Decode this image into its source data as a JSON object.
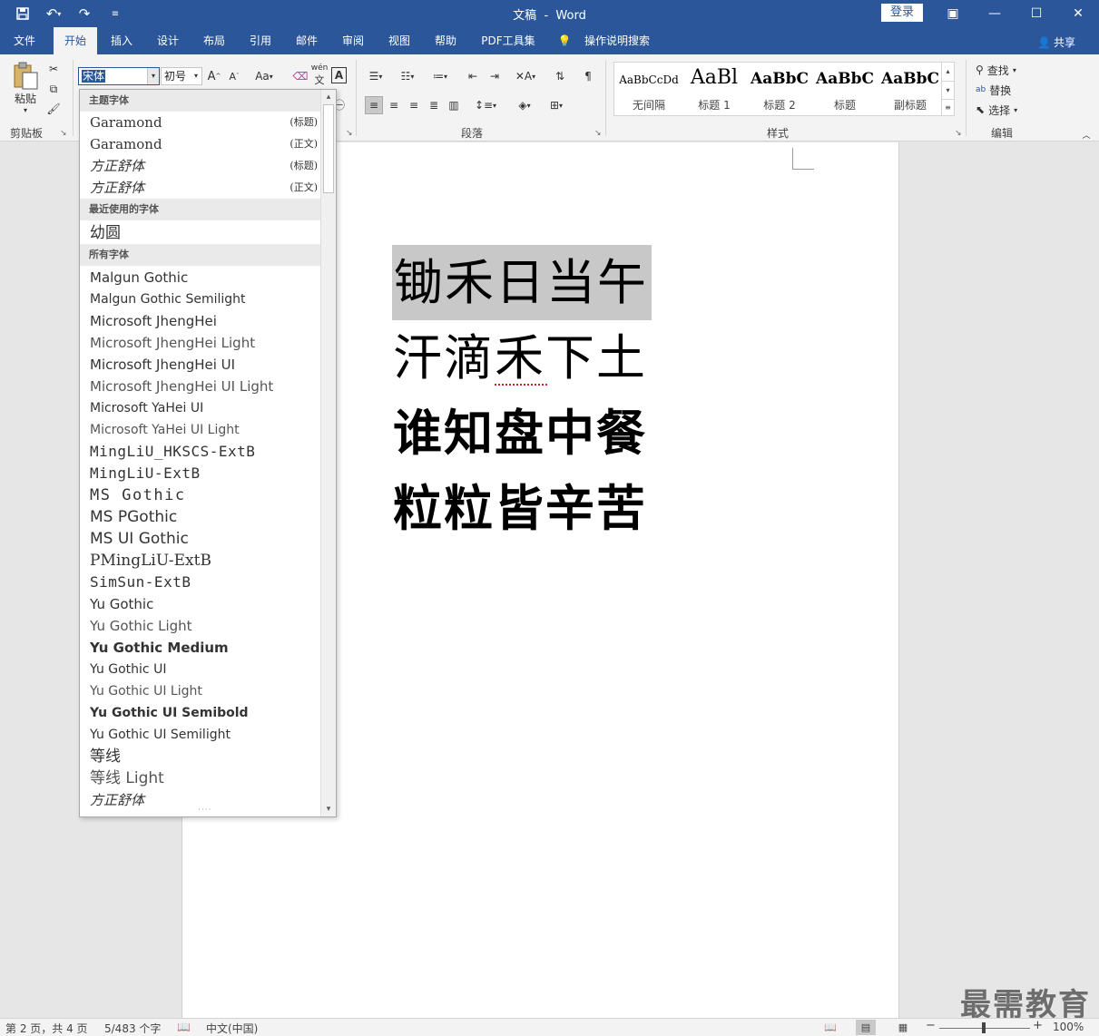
{
  "titlebar": {
    "doc_title": "文稿",
    "separator": "-",
    "app_name": "Word",
    "login_label": "登录"
  },
  "tabs": [
    {
      "label": "文件"
    },
    {
      "label": "开始"
    },
    {
      "label": "插入"
    },
    {
      "label": "设计"
    },
    {
      "label": "布局"
    },
    {
      "label": "引用"
    },
    {
      "label": "邮件"
    },
    {
      "label": "审阅"
    },
    {
      "label": "视图"
    },
    {
      "label": "帮助"
    },
    {
      "label": "PDF工具集"
    },
    {
      "label": "操作说明搜索"
    }
  ],
  "share_label": "共享",
  "ribbon": {
    "clipboard": {
      "paste_label": "粘贴",
      "group_label": "剪贴板"
    },
    "font": {
      "font_name": "宋体",
      "font_size": "初号",
      "case_label": "Aa",
      "pinyin_label": "wén"
    },
    "paragraph": {
      "group_label": "段落"
    },
    "styles": {
      "group_label": "样式",
      "items": [
        {
          "preview": "AaBbCcDd",
          "label": "无间隔"
        },
        {
          "preview": "AaBl",
          "label": "标题 1"
        },
        {
          "preview": "AaBbC",
          "label": "标题 2"
        },
        {
          "preview": "AaBbC",
          "label": "标题"
        },
        {
          "preview": "AaBbC",
          "label": "副标题"
        }
      ]
    },
    "editing": {
      "find": "查找",
      "replace": "替换",
      "select": "选择",
      "group_label": "编辑"
    }
  },
  "font_dropdown": {
    "theme_header": "主题字体",
    "theme_fonts": [
      {
        "name": "Garamond",
        "tag": "(标题)"
      },
      {
        "name": "Garamond",
        "tag": "(正文)"
      },
      {
        "name": "方正舒体",
        "tag": "(标题)"
      },
      {
        "name": "方正舒体",
        "tag": "(正文)"
      }
    ],
    "recent_header": "最近使用的字体",
    "recent_fonts": [
      "幼圆"
    ],
    "all_header": "所有字体",
    "all_fonts": [
      "Malgun Gothic",
      "Malgun Gothic Semilight",
      "Microsoft JhengHei",
      "Microsoft JhengHei Light",
      "Microsoft JhengHei UI",
      "Microsoft JhengHei UI Light",
      "Microsoft YaHei UI",
      "Microsoft YaHei UI Light",
      "MingLiU_HKSCS-ExtB",
      "MingLiU-ExtB",
      "MS Gothic",
      "MS PGothic",
      "MS UI Gothic",
      "PMingLiU-ExtB",
      "SimSun-ExtB",
      "Yu Gothic",
      "Yu Gothic Light",
      "Yu Gothic Medium",
      "Yu Gothic UI",
      "Yu Gothic UI Light",
      "Yu Gothic UI Semibold",
      "Yu Gothic UI Semilight",
      "等线",
      "等线 Light",
      "方正舒体"
    ]
  },
  "document": {
    "lines": [
      "锄禾日当午",
      "汗滴禾下土",
      "谁知盘中餐",
      "粒粒皆辛苦"
    ]
  },
  "statusbar": {
    "page_info": "第 2 页，共 4 页",
    "word_count": "5/483 个字",
    "language": "中文(中国)",
    "zoom": "100%"
  },
  "watermark": "最需教育"
}
